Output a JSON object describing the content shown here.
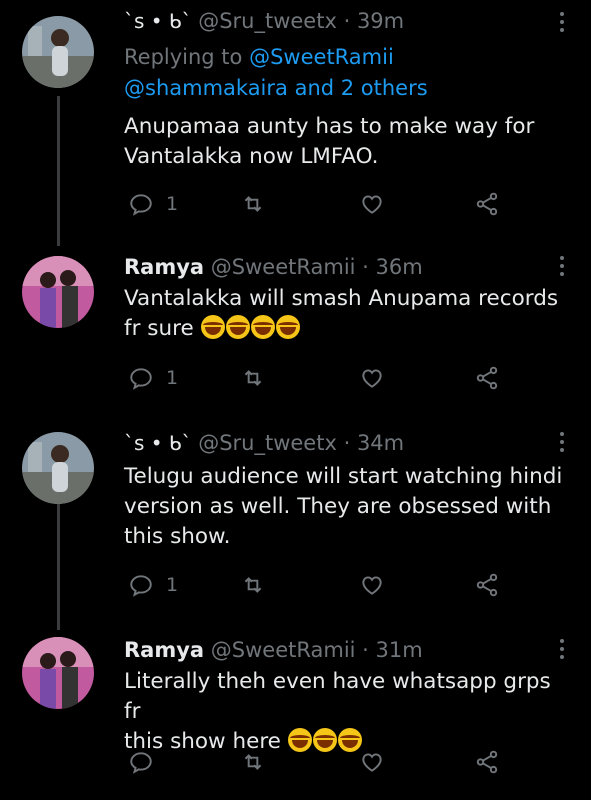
{
  "tweets": [
    {
      "user_symbols": "`s • ᑲ`",
      "handle": "@Sru_tweetx",
      "time": "39m",
      "replying_prefix": "Replying to",
      "replying_user": "@SweetRamii",
      "replying_more": "@shammakaira and 2 others",
      "text": "Anupamaa aunty has to make way for Vantalakka now LMFAO.",
      "reply_count": "1"
    },
    {
      "name": "Ramya",
      "handle": "@SweetRamii",
      "time": "36m",
      "text_line1": "Vantalakka will smash Anupama records",
      "text_line2": "fr sure",
      "reply_count": "1"
    },
    {
      "user_symbols": "`s • ᑲ`",
      "handle": "@Sru_tweetx",
      "time": "34m",
      "text": "Telugu audience will start watching hindi version as well. They are obsessed with this show.",
      "reply_count": "1"
    },
    {
      "name": "Ramya",
      "handle": "@SweetRamii",
      "time": "31m",
      "text_line1": "Literally theh even have whatsapp grps fr",
      "text_line2": "this show here"
    }
  ],
  "dot_separator": "·",
  "icons": [
    "reply-icon",
    "retweet-icon",
    "like-icon",
    "share-icon",
    "more-icon"
  ],
  "colors": {
    "background": "#000000",
    "muted": "#71767b",
    "link": "#1d9bf0",
    "text": "#e7e9ea"
  }
}
